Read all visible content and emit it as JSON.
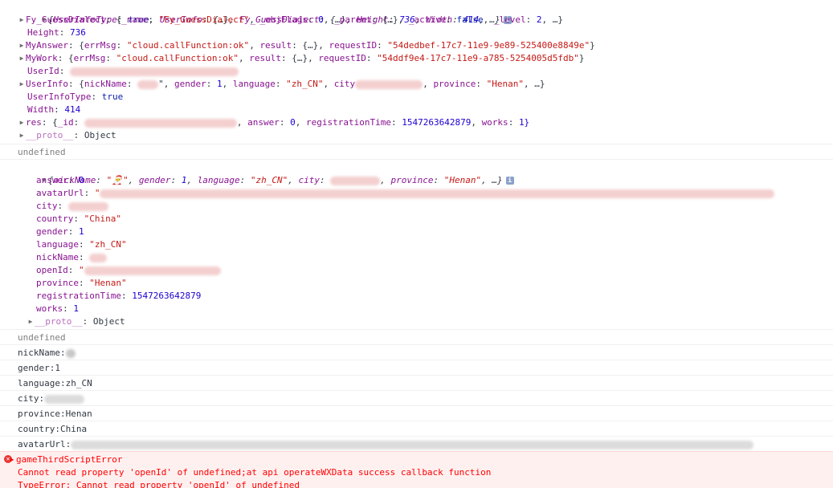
{
  "obj1": {
    "summary": {
      "open": "{",
      "k1": "UserInfoType",
      "v1": "true",
      "k2": "UserInfo",
      "v2": "{…}",
      "k3": "Fy_GuessDialect",
      "v3": "{…}",
      "k4": "Height",
      "v4": "736",
      "k5": "Width",
      "v5": "414",
      "tail": "…}"
    },
    "fy": {
      "key": "Fy_GuessDialect",
      "name_key": "_name",
      "name_val": "\"Fy_GuessDialect\"",
      "flags_key": "_objFlags",
      "flags_val": "0",
      "parent_key": "_parent",
      "parent_val": "{…}",
      "active_key": "_active",
      "active_val": "false",
      "level_key": "_level",
      "level_val": "2",
      "tail": "…}"
    },
    "height": {
      "key": "Height",
      "val": "736"
    },
    "myanswer": {
      "key": "MyAnswer",
      "errmsg_key": "errMsg",
      "errmsg_val": "\"cloud.callFunction:ok\"",
      "result_key": "result",
      "result_val": "{…}",
      "req_key": "requestID",
      "req_val": "\"54dedbef-17c7-11e9-9e89-525400e8849e\""
    },
    "mywork": {
      "key": "MyWork",
      "errmsg_key": "errMsg",
      "errmsg_val": "\"cloud.callFunction:ok\"",
      "result_key": "result",
      "result_val": "{…}",
      "req_key": "requestID",
      "req_val": "\"54ddf9e4-17c7-11e9-a785-5254005d5fdb\""
    },
    "userid": {
      "key": "UserId"
    },
    "userinfo": {
      "key": "UserInfo",
      "nick_key": "nickName",
      "gender_key": "gender",
      "gender_val": "1",
      "lang_key": "language",
      "lang_val": "\"zh_CN\"",
      "city_key": "city",
      "prov_key": "province",
      "prov_val": "\"Henan\"",
      "tail": "…}"
    },
    "userinfotype": {
      "key": "UserInfoType",
      "val": "true"
    },
    "width": {
      "key": "Width",
      "val": "414"
    },
    "res": {
      "key": "res",
      "id_key": "_id",
      "answer_key": "answer",
      "answer_val": "0",
      "reg_key": "registrationTime",
      "reg_val": "1547263642879",
      "works_key": "works",
      "works_val": "1}"
    },
    "proto": {
      "key": "__proto__",
      "val": "Object"
    }
  },
  "undefined1": "undefined",
  "obj2": {
    "summary": {
      "nick_key": "nickName",
      "nick_val": "\"",
      "nick_glyph": "🎅",
      "gender_key": "gender",
      "gender_val": "1",
      "lang_key": "language",
      "lang_val": "\"zh_CN\"",
      "city_key": "city",
      "prov_key": "province",
      "prov_val": "\"Henan\"",
      "tail": "…}"
    },
    "answer": {
      "key": "answer",
      "val": "0"
    },
    "avatar": {
      "key": "avatarUrl",
      "val": "\""
    },
    "city": {
      "key": "city"
    },
    "country": {
      "key": "country",
      "val": "\"China\""
    },
    "gender": {
      "key": "gender",
      "val": "1"
    },
    "language": {
      "key": "language",
      "val": "\"zh_CN\""
    },
    "nickname": {
      "key": "nickName"
    },
    "openid": {
      "key": "openId",
      "val": "\""
    },
    "province": {
      "key": "province",
      "val": "\"Henan\""
    },
    "regtime": {
      "key": "registrationTime",
      "val": "1547263642879"
    },
    "works": {
      "key": "works",
      "val": "1"
    },
    "proto": {
      "key": "__proto__",
      "val": "Object"
    }
  },
  "undefined2": "undefined",
  "logs": {
    "nickname": "nickName:",
    "gender": "gender:1",
    "language": "language:zh_CN",
    "city": "city:",
    "province": "province:Henan",
    "country": "country:China",
    "avatar": "avatarUrl:"
  },
  "error": {
    "title": "gameThirdScriptError",
    "message": "Cannot read property 'openId' of undefined;at api operateWXData success callback function",
    "type": "TypeError: Cannot read property 'openId' of undefined"
  },
  "icons": {
    "info": "i",
    "error": "✕",
    "expanded": "▼",
    "collapsed": "▶"
  },
  "colors": {
    "key": "#881391",
    "string": "#c41a16",
    "number": "#1c00cf",
    "boolean": "#0d22aa",
    "error_text": "#ff0000",
    "error_bg": "#fff0f0"
  }
}
